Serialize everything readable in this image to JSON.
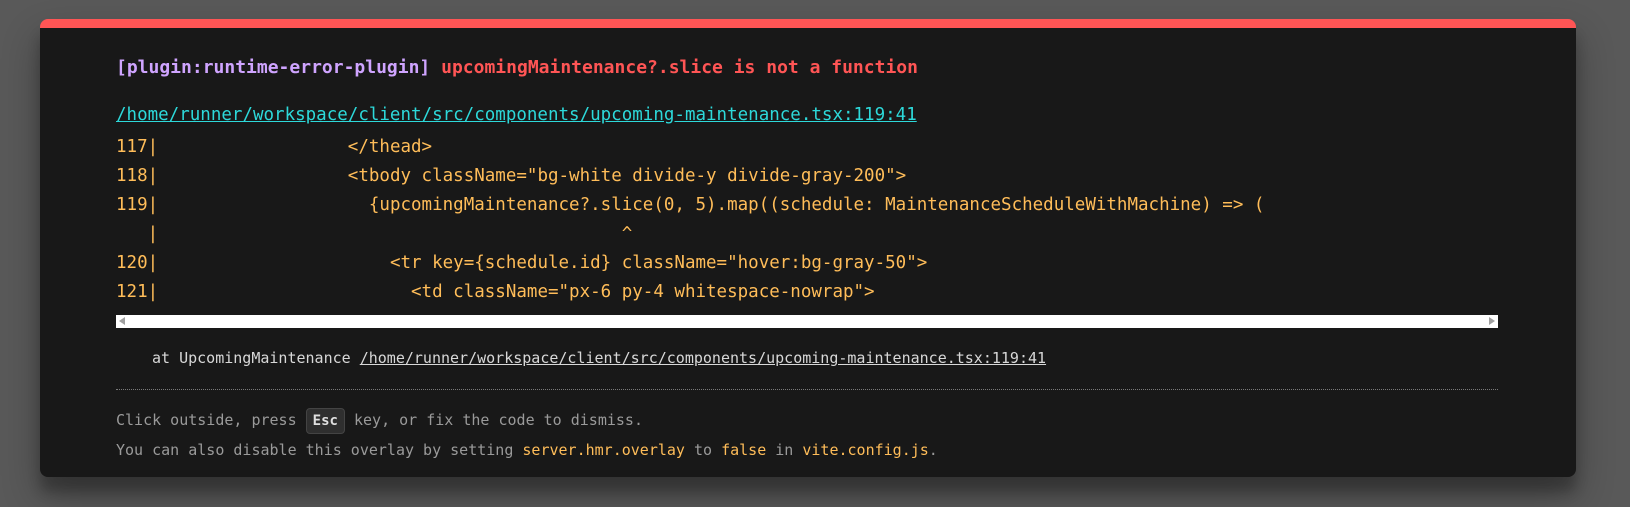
{
  "error": {
    "plugin": "[plugin:runtime-error-plugin]",
    "message": "upcomingMaintenance?.slice is not a function",
    "file": "/home/runner/workspace/client/src/components/upcoming-maintenance.tsx:119:41"
  },
  "frame": [
    {
      "num": "117",
      "code": "                  </thead>"
    },
    {
      "num": "118",
      "code": "                  <tbody className=\"bg-white divide-y divide-gray-200\">"
    },
    {
      "num": "119",
      "code": "                    {upcomingMaintenance?.slice(0, 5).map((schedule: MaintenanceScheduleWithMachine) => ("
    },
    {
      "num": "   ",
      "code": "                                            ^"
    },
    {
      "num": "120",
      "code": "                      <tr key={schedule.id} className=\"hover:bg-gray-50\">"
    },
    {
      "num": "121",
      "code": "                        <td className=\"px-6 py-4 whitespace-nowrap\">"
    }
  ],
  "stack": {
    "prefix": "at UpcomingMaintenance ",
    "link": "/home/runner/workspace/client/src/components/upcoming-maintenance.tsx:119:41"
  },
  "tip": {
    "line1_pre": "Click outside, press ",
    "key": "Esc",
    "line1_post": " key, or fix the code to dismiss.",
    "line2_pre": "You can also disable this overlay by setting ",
    "setting": "server.hmr.overlay",
    "to": " to ",
    "false": "false",
    "in": " in ",
    "config": "vite.config.js",
    "end": "."
  },
  "colors": {
    "accent": "#ff5555",
    "plugin": "#cfa4ff",
    "link": "#2dd9da",
    "code": "#ffbd59"
  }
}
